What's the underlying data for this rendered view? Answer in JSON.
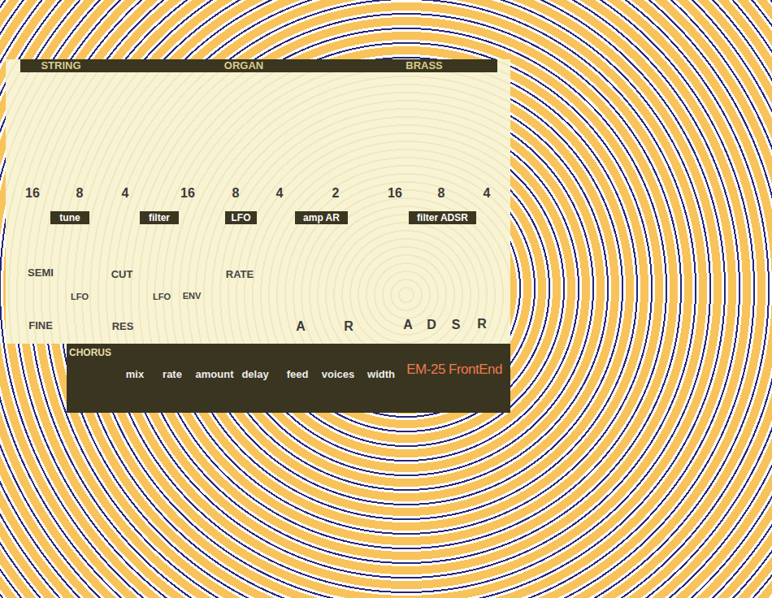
{
  "header": {
    "sections": [
      "STRING",
      "ORGAN",
      "BRASS"
    ]
  },
  "footages": [
    "16",
    "8",
    "4",
    "16",
    "8",
    "4",
    "2",
    "16",
    "8",
    "4"
  ],
  "groups": [
    "tune",
    "filter",
    "LFO",
    "amp AR",
    "filter ADSR"
  ],
  "controls": [
    {
      "label": "SEMI",
      "kind": "main"
    },
    {
      "label": "LFO",
      "kind": "sub"
    },
    {
      "label": "FINE",
      "kind": "main"
    },
    {
      "label": "CUT",
      "kind": "main"
    },
    {
      "label": "RES",
      "kind": "main"
    },
    {
      "label": "LFO",
      "kind": "sub"
    },
    {
      "label": "ENV",
      "kind": "sub"
    },
    {
      "label": "RATE",
      "kind": "main"
    },
    {
      "label": "A",
      "kind": "env"
    },
    {
      "label": "R",
      "kind": "env"
    },
    {
      "label": "A",
      "kind": "env"
    },
    {
      "label": "D",
      "kind": "env"
    },
    {
      "label": "S",
      "kind": "env"
    },
    {
      "label": "R",
      "kind": "env"
    }
  ],
  "chorus": {
    "title": "CHORUS",
    "params": [
      "mix",
      "rate",
      "amount",
      "delay",
      "feed",
      "voices",
      "width"
    ]
  },
  "brand": "EM-25 FrontEnd"
}
